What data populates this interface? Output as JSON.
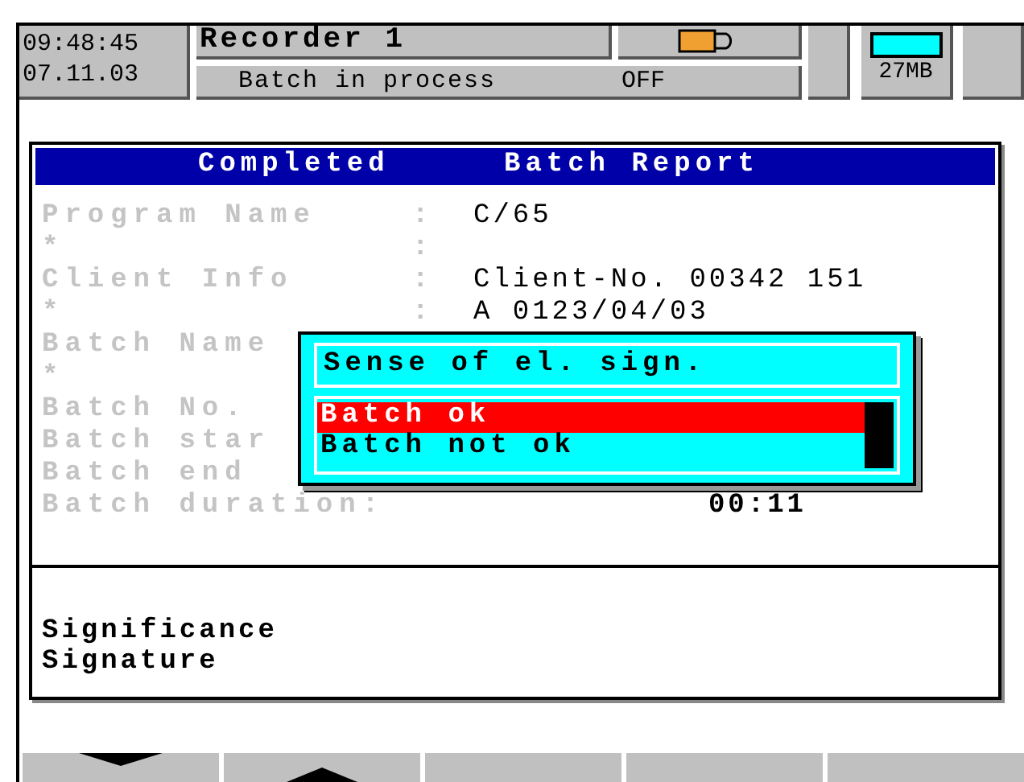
{
  "status_bar": {
    "time": "09:48:45",
    "date": "07.11.03",
    "recorder": "Recorder 1",
    "batch_status": "Batch in process",
    "batch_state": "OFF",
    "memory": "27MB"
  },
  "report": {
    "title_left": "Completed",
    "title_right": "Batch Report",
    "rows": [
      {
        "label": "Program Name",
        "colon": ":",
        "value": "C/65"
      },
      {
        "label": "*",
        "colon": ":"
      },
      {
        "label": "Client Info",
        "colon": ":",
        "value": "Client-No. 00342 151"
      },
      {
        "label": "*",
        "colon": ":",
        "value": "A 0123/04/03"
      },
      {
        "label": "Batch Name"
      },
      {
        "label": "*"
      },
      {
        "label": "Batch No."
      },
      {
        "label": "Batch star"
      },
      {
        "label": "Batch end"
      },
      {
        "label": "Batch duration:",
        "value": "00:11",
        "kind": "duration"
      }
    ],
    "signature_lines": [
      "Significance",
      "Signature"
    ]
  },
  "dialog": {
    "title": "Sense of el. sign.",
    "options": [
      {
        "label": "Batch ok",
        "selected": true
      },
      {
        "label": "Batch not ok",
        "selected": false
      }
    ]
  },
  "softkeys": [
    {
      "kind": "down"
    },
    {
      "kind": "up"
    },
    {
      "kind": "blank"
    },
    {
      "kind": "blank"
    },
    {
      "kind": "blank"
    }
  ]
}
